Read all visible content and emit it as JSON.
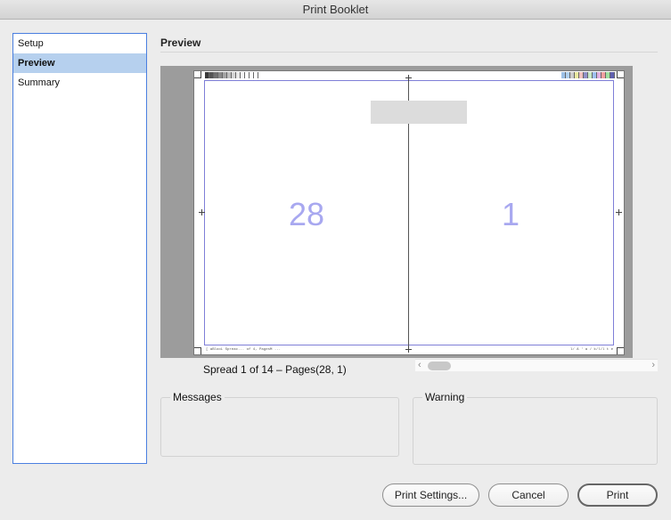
{
  "window": {
    "title": "Print Booklet"
  },
  "sidebar": {
    "items": [
      {
        "label": "Setup",
        "selected": false
      },
      {
        "label": "Preview",
        "selected": true
      },
      {
        "label": "Summary",
        "selected": false
      }
    ]
  },
  "section": {
    "title": "Preview"
  },
  "preview": {
    "left_page": "28",
    "right_page": "1",
    "slug_left_text": "[ aBlooL Spreac... of 4, PagesM ...",
    "slug_right_text": "l/ A  ' a / k/l/l t e",
    "grayscale_bar": [
      "#3a3a3a",
      "#555555",
      "#707070",
      "#8a8a8a",
      "#a5a5a5",
      "#bfbfbf",
      "#d5d5d5",
      "#e8e8e8",
      "#f5f5f5",
      "#ffffff",
      "#ffffff",
      "#ffffff"
    ],
    "color_bar": [
      "#9cc0e6",
      "#b0d0ee",
      "#cccccc",
      "#e8e8a0",
      "#f0c0c0",
      "#9090c8",
      "#c8e8c8",
      "#a0c0f0",
      "#e0b0e0",
      "#f0a0a0",
      "#a0e0a0",
      "#6060b0"
    ]
  },
  "spread": {
    "label": "Spread 1 of 14 – Pages(28, 1)"
  },
  "scrollbar": {
    "left_arrow": "‹",
    "right_arrow": "›"
  },
  "messages": {
    "title": "Messages"
  },
  "warning": {
    "title": "Warning"
  },
  "buttons": {
    "print_settings": "Print Settings...",
    "cancel": "Cancel",
    "print": "Print"
  }
}
